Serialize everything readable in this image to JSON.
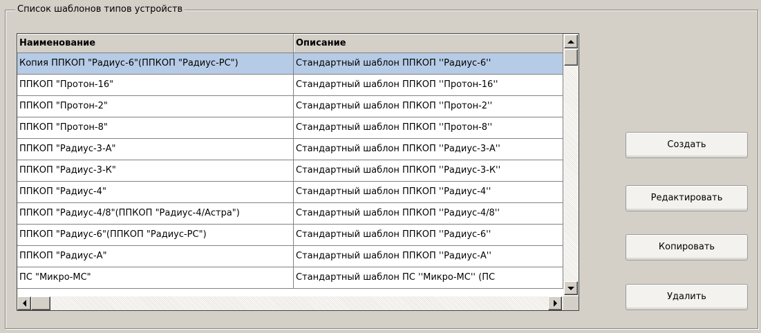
{
  "group": {
    "title": "Список шаблонов типов устройств"
  },
  "grid": {
    "columns": [
      "Наименование",
      "Описание"
    ],
    "selected_row": 0,
    "rows": [
      [
        "Копия ППКОП \"Радиус-6\"(ППКОП \"Радиус-РС\")",
        "Стандартный шаблон ППКОП ''Радиус-6''"
      ],
      [
        "ППКОП \"Протон-16\"",
        "Стандартный шаблон ППКОП ''Протон-16''"
      ],
      [
        "ППКОП \"Протон-2\"",
        "Стандартный шаблон ППКОП ''Протон-2''"
      ],
      [
        "ППКОП \"Протон-8\"",
        "Стандартный шаблон ППКОП ''Протон-8''"
      ],
      [
        "ППКОП \"Радиус-3-А\"",
        "Стандартный шаблон ППКОП ''Радиус-3-А''"
      ],
      [
        "ППКОП \"Радиус-3-К\"",
        "Стандартный шаблон ППКОП ''Радиус-3-К''"
      ],
      [
        "ППКОП \"Радиус-4\"",
        "Стандартный шаблон ППКОП ''Радиус-4''"
      ],
      [
        "ППКОП \"Радиус-4/8\"(ППКОП \"Радиус-4/Астра\")",
        "Стандартный шаблон ППКОП ''Радиус-4/8''"
      ],
      [
        "ППКОП \"Радиус-6\"(ППКОП \"Радиус-РС\")",
        "Стандартный шаблон ППКОП ''Радиус-6''"
      ],
      [
        "ППКОП \"Радиус-А\"",
        "Стандартный шаблон ППКОП ''Радиус-А''"
      ],
      [
        "ПС \"Микро-МС\"",
        "Стандартный шаблон ПС ''Микро-МС'' (ПС"
      ]
    ]
  },
  "buttons": {
    "create": "Создать",
    "edit": "Редактировать",
    "copy": "Копировать",
    "delete": "Удалить"
  },
  "icons": {
    "scroll_up": "arrow-up-icon",
    "scroll_down": "arrow-down-icon",
    "scroll_left": "arrow-left-icon",
    "scroll_right": "arrow-right-icon"
  },
  "colors": {
    "window_bg": "#d4d0c8",
    "selection_bg": "#b6cbe6",
    "grid_bg": "#ffffff"
  }
}
